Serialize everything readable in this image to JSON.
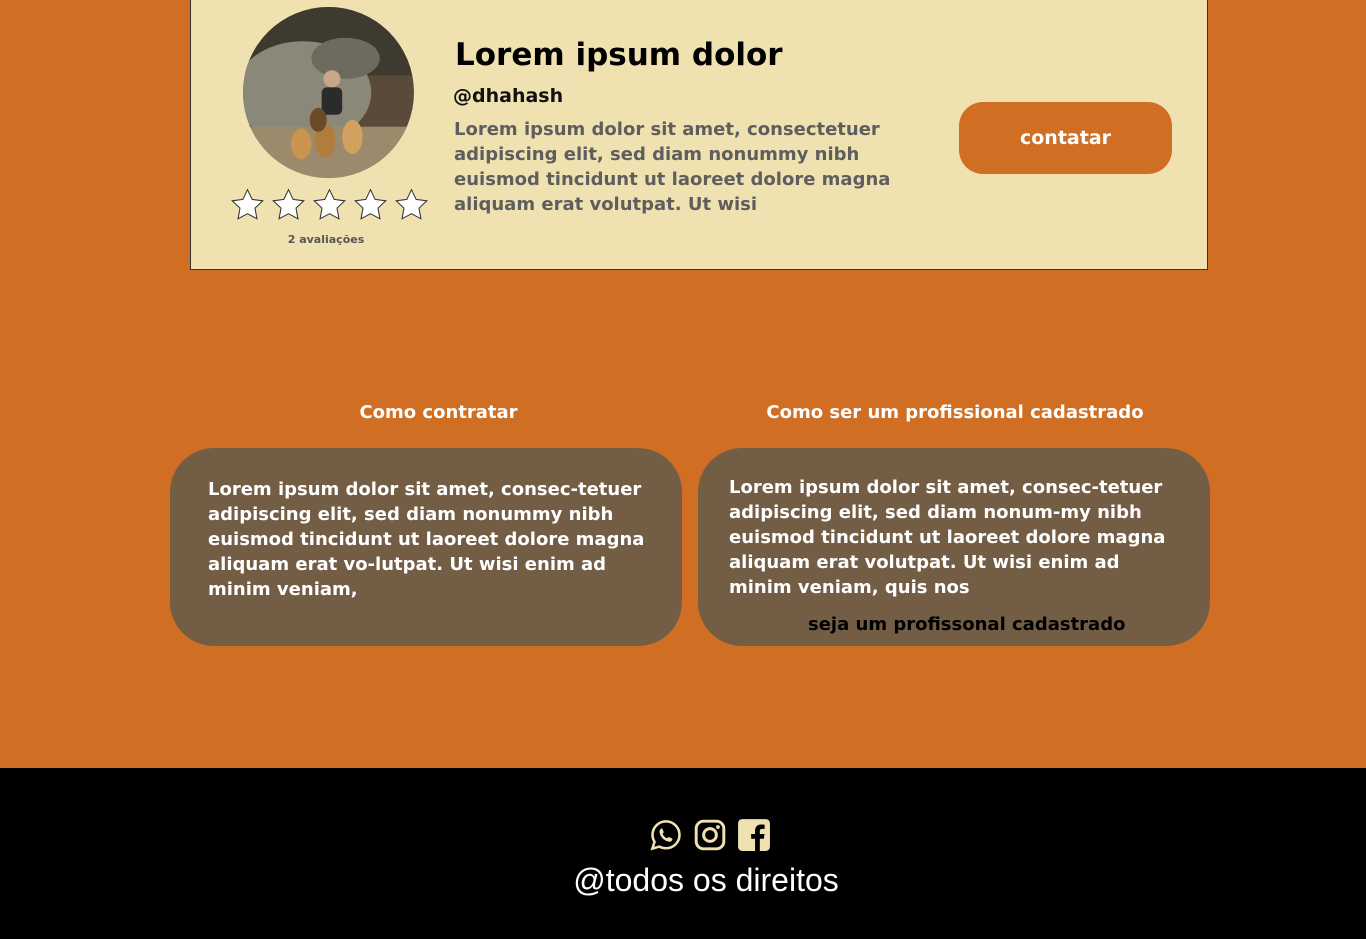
{
  "profile": {
    "name": "Lorem ipsum dolor",
    "handle": "@dhahash",
    "bio": "Lorem ipsum dolor sit amet, consectetuer adipiscing elit, sed diam nonummy nibh euismod tincidunt ut laoreet dolore magna aliquam erat volutpat. Ut wisi",
    "rating": {
      "stars_filled": 0,
      "stars_total": 5,
      "count_label": "2 avaliações"
    },
    "contact_label": "contatar",
    "avatar_icon": "profile-photo-person-with-dogs"
  },
  "sections": {
    "hire": {
      "title": "Como contratar",
      "text": "Lorem ipsum dolor sit amet, consec-tetuer adipiscing elit, sed diam nonummy nibh euismod tincidunt ut laoreet dolore magna aliquam erat vo-lutpat. Ut wisi enim ad minim veniam,"
    },
    "register": {
      "title": "Como ser um profissional cadastrado",
      "text": "Lorem ipsum dolor sit amet, consec-tetuer adipiscing elit, sed diam nonum-my nibh euismod tincidunt ut laoreet dolore magna aliquam erat volutpat. Ut wisi enim ad minim veniam, quis nos",
      "link_label": "seja um profissonal cadastrado"
    }
  },
  "footer": {
    "icons": [
      "whatsapp-icon",
      "instagram-icon",
      "facebook-icon"
    ],
    "copyright": "@todos os direitos"
  },
  "colors": {
    "background": "#d06f24",
    "card": "#f0e2b0",
    "info_box": "#735e45",
    "footer": "#000000",
    "footer_icons": "#f0e2b0"
  }
}
